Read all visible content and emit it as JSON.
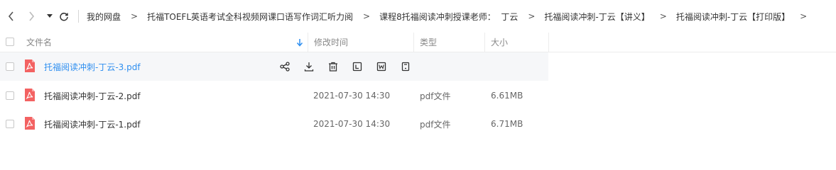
{
  "breadcrumb": {
    "items": [
      "我的网盘",
      "托福TOEFL英语考试全科视频网课口语写作词汇听力阅",
      "课程8托福阅读冲刺授课老师：  丁云",
      "托福阅读冲刺-丁云【讲义】",
      "托福阅读冲刺-丁云【打印版】"
    ],
    "separator": ">"
  },
  "columns": {
    "name": "文件名",
    "modified": "修改时间",
    "type": "类型",
    "size": "大小"
  },
  "files": [
    {
      "name": "托福阅读冲刺-丁云-3.pdf",
      "modified": "",
      "type": "",
      "size": ""
    },
    {
      "name": "托福阅读冲刺-丁云-2.pdf",
      "modified": "2021-07-30 14:30",
      "type": "pdf文件",
      "size": "6.61MB"
    },
    {
      "name": "托福阅读冲刺-丁云-1.pdf",
      "modified": "2021-07-30 14:30",
      "type": "pdf文件",
      "size": "6.71MB"
    }
  ],
  "row_actions": [
    "share-icon",
    "download-icon",
    "delete-icon",
    "rename-icon",
    "word-convert-icon",
    "more-icon"
  ],
  "colors": {
    "accent": "#2f8ff0",
    "pdf": "#f36262",
    "hover_row": "#f6f7f9"
  }
}
